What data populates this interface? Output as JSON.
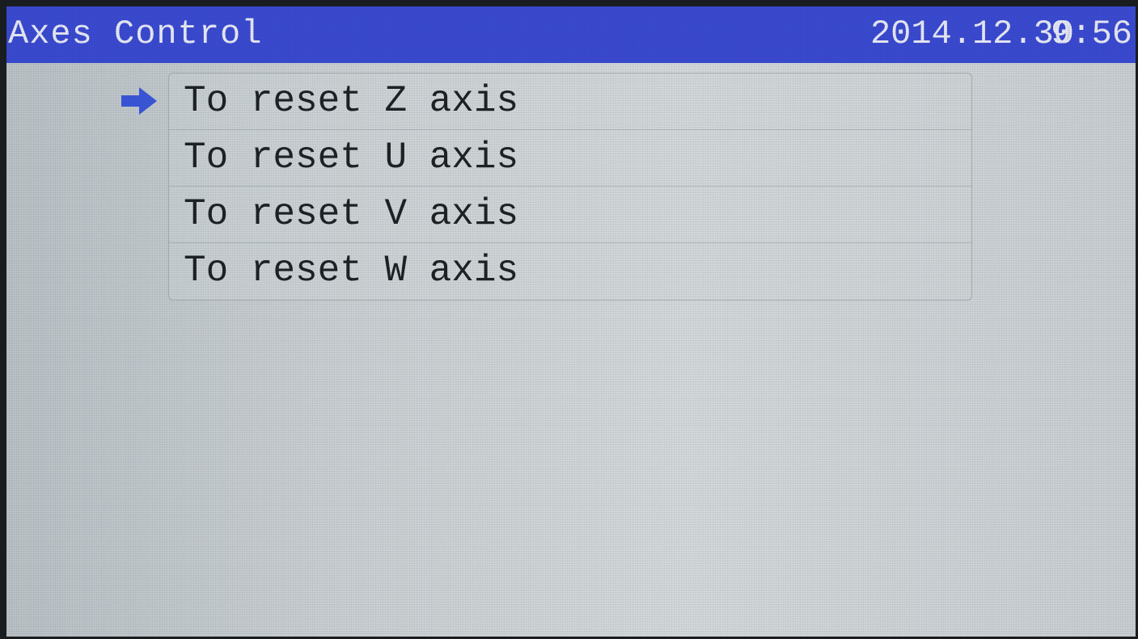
{
  "header": {
    "title": "Axes Control",
    "date": "2014.12.30",
    "time": "9:56"
  },
  "menu": {
    "selected_index": 0,
    "items": [
      {
        "label": "To reset Z axis"
      },
      {
        "label": "To reset U axis"
      },
      {
        "label": "To reset V axis"
      },
      {
        "label": "To reset W axis"
      }
    ]
  },
  "colors": {
    "title_bar": "#3a4ad0",
    "title_text": "#e6e8f5",
    "cursor_arrow": "#3a56d8",
    "menu_text": "#1e2226"
  },
  "icons": {
    "cursor": "right-arrow-icon"
  }
}
